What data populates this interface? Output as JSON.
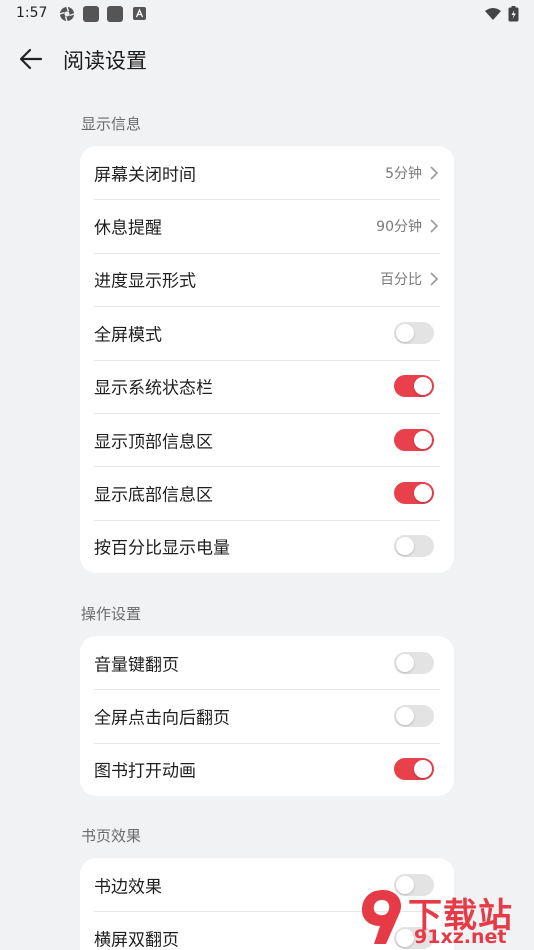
{
  "status_bar": {
    "time": "1:57"
  },
  "header": {
    "title": "阅读设置"
  },
  "sections": [
    {
      "label": "显示信息",
      "items": [
        {
          "label": "屏幕关闭时间",
          "type": "value",
          "value": "5分钟"
        },
        {
          "label": "休息提醒",
          "type": "value",
          "value": "90分钟"
        },
        {
          "label": "进度显示形式",
          "type": "value",
          "value": "百分比"
        },
        {
          "label": "全屏模式",
          "type": "toggle",
          "on": false
        },
        {
          "label": "显示系统状态栏",
          "type": "toggle",
          "on": true
        },
        {
          "label": "显示顶部信息区",
          "type": "toggle",
          "on": true
        },
        {
          "label": "显示底部信息区",
          "type": "toggle",
          "on": true
        },
        {
          "label": "按百分比显示电量",
          "type": "toggle",
          "on": false
        }
      ]
    },
    {
      "label": "操作设置",
      "items": [
        {
          "label": "音量键翻页",
          "type": "toggle",
          "on": false
        },
        {
          "label": "全屏点击向后翻页",
          "type": "toggle",
          "on": false
        },
        {
          "label": "图书打开动画",
          "type": "toggle",
          "on": true
        }
      ]
    },
    {
      "label": "书页效果",
      "items": [
        {
          "label": "书边效果",
          "type": "toggle",
          "on": false
        },
        {
          "label": "横屏双翻页",
          "type": "toggle",
          "on": false
        }
      ]
    }
  ],
  "watermark": {
    "big": "下载站",
    "url": "91xz.net"
  },
  "colors": {
    "accent": "#e8414c",
    "background": "#f1f2f4",
    "card": "#ffffff"
  }
}
